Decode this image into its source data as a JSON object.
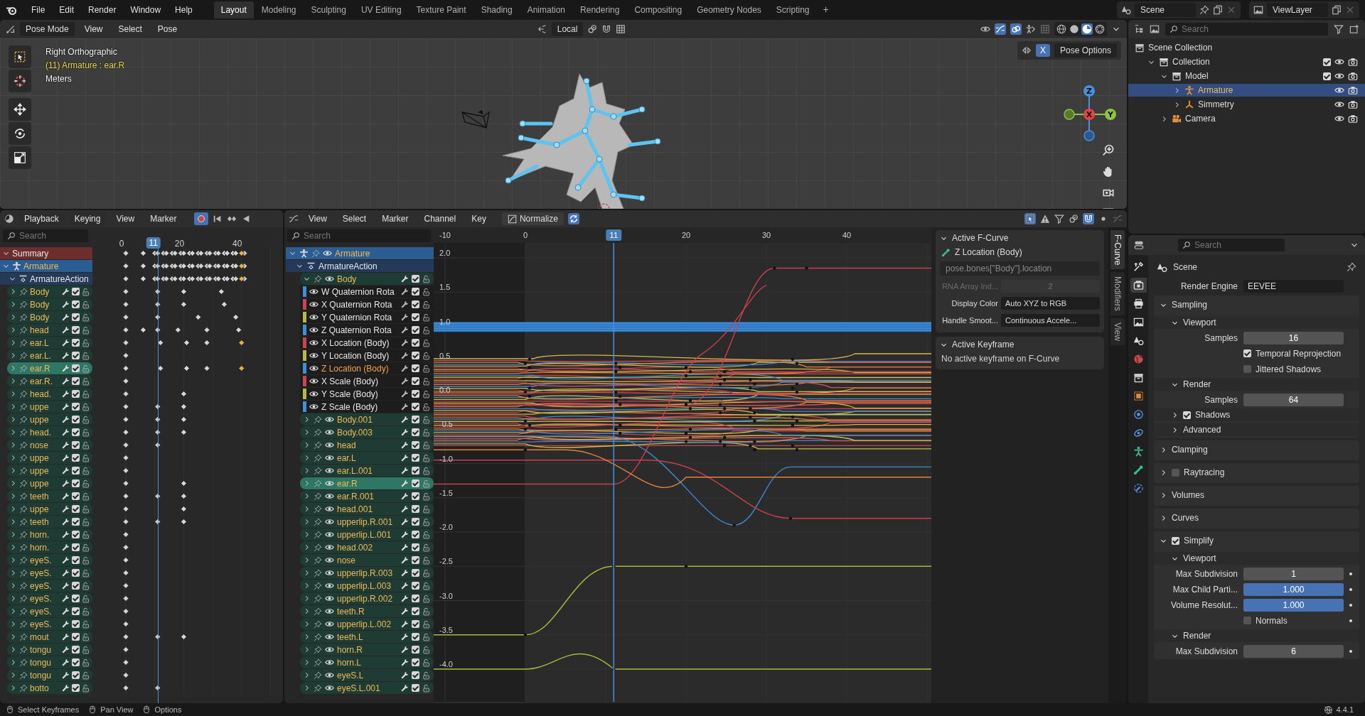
{
  "top_bar": {
    "menus": [
      "File",
      "Edit",
      "Render",
      "Window",
      "Help"
    ],
    "workspaces": [
      {
        "label": "Layout",
        "selected": true
      },
      {
        "label": "Modeling",
        "selected": false
      },
      {
        "label": "Sculpting",
        "selected": false
      },
      {
        "label": "UV Editing",
        "selected": false
      },
      {
        "label": "Texture Paint",
        "selected": false
      },
      {
        "label": "Shading",
        "selected": false
      },
      {
        "label": "Animation",
        "selected": false
      },
      {
        "label": "Rendering",
        "selected": false
      },
      {
        "label": "Compositing",
        "selected": false
      },
      {
        "label": "Geometry Nodes",
        "selected": false
      },
      {
        "label": "Scripting",
        "selected": false
      }
    ],
    "add_workspace": "+",
    "scene": "Scene",
    "view_layer": "ViewLayer"
  },
  "viewport": {
    "mode": "Pose Mode",
    "menus": [
      "View",
      "Select",
      "Pose"
    ],
    "orientation": "Local",
    "shading_modes": [
      {
        "kind": "wireframe",
        "selected": false
      },
      {
        "kind": "solid",
        "selected": false
      },
      {
        "kind": "material",
        "selected": true
      },
      {
        "kind": "rendered",
        "selected": false
      }
    ],
    "mirror_x": {
      "label": "X",
      "on": true
    },
    "pose_options": "Pose Options",
    "overlay": {
      "view": "Right Orthographic",
      "context": "(11) Armature : ear.R",
      "units": "Meters"
    },
    "gizmo": {
      "x": "X",
      "y": "Y",
      "z": "Z"
    }
  },
  "outliner": {
    "search_placeholder": "Search",
    "tree": [
      {
        "label": "Scene Collection",
        "kind": "scene_collection",
        "children": [
          {
            "label": "Collection",
            "kind": "collection",
            "expanded": true,
            "checked": true,
            "children": [
              {
                "label": "Model",
                "kind": "collection",
                "expanded": true,
                "checked": true,
                "children": [
                  {
                    "label": "Armature",
                    "kind": "armature",
                    "expanded": false,
                    "selected": true
                  },
                  {
                    "label": "Simmetry",
                    "kind": "empty",
                    "expanded": false,
                    "selected": false
                  }
                ]
              },
              {
                "label": "Camera",
                "kind": "camera",
                "expanded": false,
                "selected": false
              }
            ]
          }
        ]
      }
    ]
  },
  "dopesheet": {
    "menus": [
      "Playback",
      "Keying",
      "View",
      "Marker"
    ],
    "auto_key": true,
    "search_placeholder": "Search",
    "frame_ticks": [
      "0",
      "20",
      "40"
    ],
    "current_frame": "11",
    "rows": [
      {
        "label": "Summary",
        "kind": "summary"
      },
      {
        "label": "Armature",
        "kind": "object"
      },
      {
        "label": "ArmatureAction",
        "kind": "action"
      },
      {
        "label": "Body",
        "kind": "bone",
        "selected": false,
        "checked": true
      },
      {
        "label": "Body",
        "kind": "bone",
        "selected": false,
        "checked": true
      },
      {
        "label": "Body",
        "kind": "bone",
        "selected": false,
        "checked": true
      },
      {
        "label": "head",
        "kind": "bone",
        "selected": false,
        "checked": true
      },
      {
        "label": "ear.L",
        "kind": "bone",
        "selected": false,
        "checked": true
      },
      {
        "label": "ear.L.",
        "kind": "bone",
        "selected": false,
        "checked": true
      },
      {
        "label": "ear.R",
        "kind": "bone",
        "selected": true,
        "checked": true
      },
      {
        "label": "ear.R.",
        "kind": "bone",
        "selected": false,
        "checked": true
      },
      {
        "label": "head.",
        "kind": "bone",
        "selected": false,
        "checked": true
      },
      {
        "label": "uppe",
        "kind": "bone",
        "selected": false,
        "checked": true
      },
      {
        "label": "uppe",
        "kind": "bone",
        "selected": false,
        "checked": true
      },
      {
        "label": "head.",
        "kind": "bone",
        "selected": false,
        "checked": true
      },
      {
        "label": "nose",
        "kind": "bone",
        "selected": false,
        "checked": true
      },
      {
        "label": "uppe",
        "kind": "bone",
        "selected": false,
        "checked": true
      },
      {
        "label": "uppe",
        "kind": "bone",
        "selected": false,
        "checked": true
      },
      {
        "label": "uppe",
        "kind": "bone",
        "selected": false,
        "checked": true
      },
      {
        "label": "teeth",
        "kind": "bone",
        "selected": false,
        "checked": true
      },
      {
        "label": "uppe",
        "kind": "bone",
        "selected": false,
        "checked": true
      },
      {
        "label": "teeth",
        "kind": "bone",
        "selected": false,
        "checked": true
      },
      {
        "label": "horn.",
        "kind": "bone",
        "selected": false,
        "checked": true
      },
      {
        "label": "horn.",
        "kind": "bone",
        "selected": false,
        "checked": true
      },
      {
        "label": "eyeS.",
        "kind": "bone",
        "selected": false,
        "checked": true
      },
      {
        "label": "eyeS.",
        "kind": "bone",
        "selected": false,
        "checked": true
      },
      {
        "label": "eyeS.",
        "kind": "bone",
        "selected": false,
        "checked": true
      },
      {
        "label": "eyeS.",
        "kind": "bone",
        "selected": false,
        "checked": true
      },
      {
        "label": "eyeS.",
        "kind": "bone",
        "selected": false,
        "checked": true
      },
      {
        "label": "eyeS.",
        "kind": "bone",
        "selected": false,
        "checked": true
      },
      {
        "label": "mout",
        "kind": "bone",
        "selected": false,
        "checked": true
      },
      {
        "label": "tongu",
        "kind": "bone",
        "selected": false,
        "checked": true
      },
      {
        "label": "tongu",
        "kind": "bone",
        "selected": false,
        "checked": true
      },
      {
        "label": "tongu",
        "kind": "bone",
        "selected": false,
        "checked": true
      },
      {
        "label": "botto",
        "kind": "bone",
        "selected": false,
        "checked": true
      }
    ]
  },
  "graph_editor": {
    "menus": [
      "View",
      "Select",
      "Marker",
      "Channel",
      "Key"
    ],
    "normalize": "Normalize",
    "search_placeholder": "Search",
    "x_ticks": [
      "-10",
      "0",
      "20",
      "30",
      "40"
    ],
    "current_frame": "11",
    "y_ticks": [
      "2.0",
      "1.5",
      "1.0",
      "0.5",
      "0.0",
      "-0.5",
      "-1.0",
      "-1.5",
      "-2.0",
      "-2.5",
      "-3.0",
      "-3.5",
      "-4.0"
    ],
    "channels": [
      {
        "label": "Armature",
        "kind": "object"
      },
      {
        "label": "ArmatureAction",
        "kind": "action"
      },
      {
        "label": "Body",
        "kind": "group",
        "expanded": true,
        "selected": false,
        "checked": true
      },
      {
        "label": "W Quaternion Rota",
        "kind": "curve",
        "color": "#3d8fd6",
        "selected": false,
        "checked": true
      },
      {
        "label": "X Quaternion Rota",
        "kind": "curve",
        "color": "#c9454f",
        "selected": false,
        "checked": true
      },
      {
        "label": "Y Quaternion Rota",
        "kind": "curve",
        "color": "#b5b84a",
        "selected": false,
        "checked": true
      },
      {
        "label": "Z Quaternion Rota",
        "kind": "curve",
        "color": "#3d8fd6",
        "selected": false,
        "checked": true
      },
      {
        "label": "X Location (Body)",
        "kind": "curve",
        "color": "#c9454f",
        "selected": false,
        "checked": true
      },
      {
        "label": "Y Location (Body)",
        "kind": "curve",
        "color": "#b5b84a",
        "selected": false,
        "checked": true
      },
      {
        "label": "Z Location (Body)",
        "kind": "curve",
        "color": "#3d8fd6",
        "selected": true,
        "checked": true
      },
      {
        "label": "X Scale (Body)",
        "kind": "curve",
        "color": "#c9454f",
        "selected": false,
        "checked": true
      },
      {
        "label": "Y Scale (Body)",
        "kind": "curve",
        "color": "#b5b84a",
        "selected": false,
        "checked": true
      },
      {
        "label": "Z Scale (Body)",
        "kind": "curve",
        "color": "#3d8fd6",
        "selected": false,
        "checked": true
      },
      {
        "label": "Body.001",
        "kind": "group",
        "expanded": false,
        "selected": false,
        "checked": true
      },
      {
        "label": "Body.003",
        "kind": "group",
        "expanded": false,
        "selected": false,
        "checked": true
      },
      {
        "label": "head",
        "kind": "group",
        "expanded": false,
        "selected": false,
        "checked": true
      },
      {
        "label": "ear.L",
        "kind": "group",
        "expanded": false,
        "selected": false,
        "checked": true
      },
      {
        "label": "ear.L.001",
        "kind": "group",
        "expanded": false,
        "selected": false,
        "checked": true
      },
      {
        "label": "ear.R",
        "kind": "group",
        "expanded": false,
        "selected": true,
        "checked": true
      },
      {
        "label": "ear.R.001",
        "kind": "group",
        "expanded": false,
        "selected": false,
        "checked": true
      },
      {
        "label": "head.001",
        "kind": "group",
        "expanded": false,
        "selected": false,
        "checked": true
      },
      {
        "label": "upperlip.R.001",
        "kind": "group",
        "expanded": false,
        "selected": false,
        "checked": true
      },
      {
        "label": "upperlip.L.001",
        "kind": "group",
        "expanded": false,
        "selected": false,
        "checked": true
      },
      {
        "label": "head.002",
        "kind": "group",
        "expanded": false,
        "selected": false,
        "checked": true
      },
      {
        "label": "nose",
        "kind": "group",
        "expanded": false,
        "selected": false,
        "checked": true
      },
      {
        "label": "upperlip.R.003",
        "kind": "group",
        "expanded": false,
        "selected": false,
        "checked": true
      },
      {
        "label": "upperlip.L.003",
        "kind": "group",
        "expanded": false,
        "selected": false,
        "checked": true
      },
      {
        "label": "upperlip.R.002",
        "kind": "group",
        "expanded": false,
        "selected": false,
        "checked": true
      },
      {
        "label": "teeth.R",
        "kind": "group",
        "expanded": false,
        "selected": false,
        "checked": true
      },
      {
        "label": "upperlip.L.002",
        "kind": "group",
        "expanded": false,
        "selected": false,
        "checked": true
      },
      {
        "label": "teeth.L",
        "kind": "group",
        "expanded": false,
        "selected": false,
        "checked": true
      },
      {
        "label": "horn.R",
        "kind": "group",
        "expanded": false,
        "selected": false,
        "checked": true
      },
      {
        "label": "horn.L",
        "kind": "group",
        "expanded": false,
        "selected": false,
        "checked": true
      },
      {
        "label": "eyeS.L",
        "kind": "group",
        "expanded": false,
        "selected": false,
        "checked": true
      },
      {
        "label": "eyeS.L.001",
        "kind": "group",
        "expanded": false,
        "selected": false,
        "checked": true
      }
    ],
    "sidebar": {
      "tabs": [
        {
          "label": "F-Curve",
          "selected": true
        },
        {
          "label": "Modifiers",
          "selected": false
        },
        {
          "label": "View",
          "selected": false
        }
      ],
      "fcurve_panel": {
        "title": "Active F-Curve",
        "curve_name": "Z Location (Body)",
        "data_path": "pose.bones[\"Body\"].location",
        "rna_label": "RNA Array Ind...",
        "rna_value": "2",
        "color_label": "Display Color",
        "color_value": "Auto XYZ to RGB",
        "smoothing_label": "Handle Smoot...",
        "smoothing_value": "Continuous Accele..."
      },
      "keyframe_panel": {
        "title": "Active Keyframe",
        "message": "No active keyframe on F-Curve"
      }
    }
  },
  "properties": {
    "search_placeholder": "Search",
    "context": "Scene",
    "tabs": [
      {
        "kind": "tool",
        "selected": false
      },
      {
        "kind": "render",
        "selected": true
      },
      {
        "kind": "output",
        "selected": false
      },
      {
        "kind": "view_layer",
        "selected": false
      },
      {
        "kind": "scene",
        "selected": false
      },
      {
        "kind": "world",
        "selected": false
      },
      {
        "kind": "collection",
        "selected": false
      },
      {
        "kind": "object",
        "selected": false
      },
      {
        "kind": "physics",
        "selected": false
      },
      {
        "kind": "constraints",
        "selected": false
      },
      {
        "kind": "data",
        "selected": false
      },
      {
        "kind": "bone",
        "selected": false
      },
      {
        "kind": "bone_constraint",
        "selected": false
      }
    ],
    "render_engine": {
      "label": "Render Engine",
      "value": "EEVEE"
    },
    "panels": [
      {
        "label": "Sampling",
        "expanded": true,
        "items": [
          {
            "kind": "subheader",
            "label": "Viewport",
            "expanded": true
          },
          {
            "kind": "number",
            "label": "Samples",
            "value": "16"
          },
          {
            "kind": "checkbox",
            "label": "Temporal Reprojection",
            "checked": true
          },
          {
            "kind": "checkbox",
            "label": "Jittered Shadows",
            "checked": false
          },
          {
            "kind": "subheader",
            "label": "Render",
            "expanded": true
          },
          {
            "kind": "number",
            "label": "Samples",
            "value": "64"
          },
          {
            "kind": "subheader",
            "label": "Shadows",
            "expanded": false,
            "checked": true
          },
          {
            "kind": "subheader",
            "label": "Advanced",
            "expanded": false
          }
        ]
      },
      {
        "label": "Clamping",
        "expanded": false
      },
      {
        "label": "Raytracing",
        "expanded": false,
        "checked": false
      },
      {
        "label": "Volumes",
        "expanded": false
      },
      {
        "label": "Curves",
        "expanded": false
      },
      {
        "label": "Simplify",
        "expanded": true,
        "checked": true,
        "items": [
          {
            "kind": "subheader",
            "label": "Viewport",
            "expanded": true
          },
          {
            "kind": "number",
            "label": "Max Subdivision",
            "value": "1",
            "keyframe_dot": true
          },
          {
            "kind": "slider",
            "label": "Max Child Parti...",
            "value": "1.000",
            "level": 1,
            "keyframe_dot": true
          },
          {
            "kind": "slider",
            "label": "Volume Resolut...",
            "value": "1.000",
            "level": 1,
            "keyframe_dot": true
          },
          {
            "kind": "checkbox",
            "label": "Normals",
            "checked": false,
            "keyframe_dot": true
          },
          {
            "kind": "subheader",
            "label": "Render",
            "expanded": true
          },
          {
            "kind": "number",
            "label": "Max Subdivision",
            "value": "6",
            "keyframe_dot": true
          }
        ]
      }
    ]
  },
  "status_bar": {
    "hints": [
      "Select Keyframes",
      "Pan View",
      "Options"
    ],
    "version": "4.4.1"
  }
}
